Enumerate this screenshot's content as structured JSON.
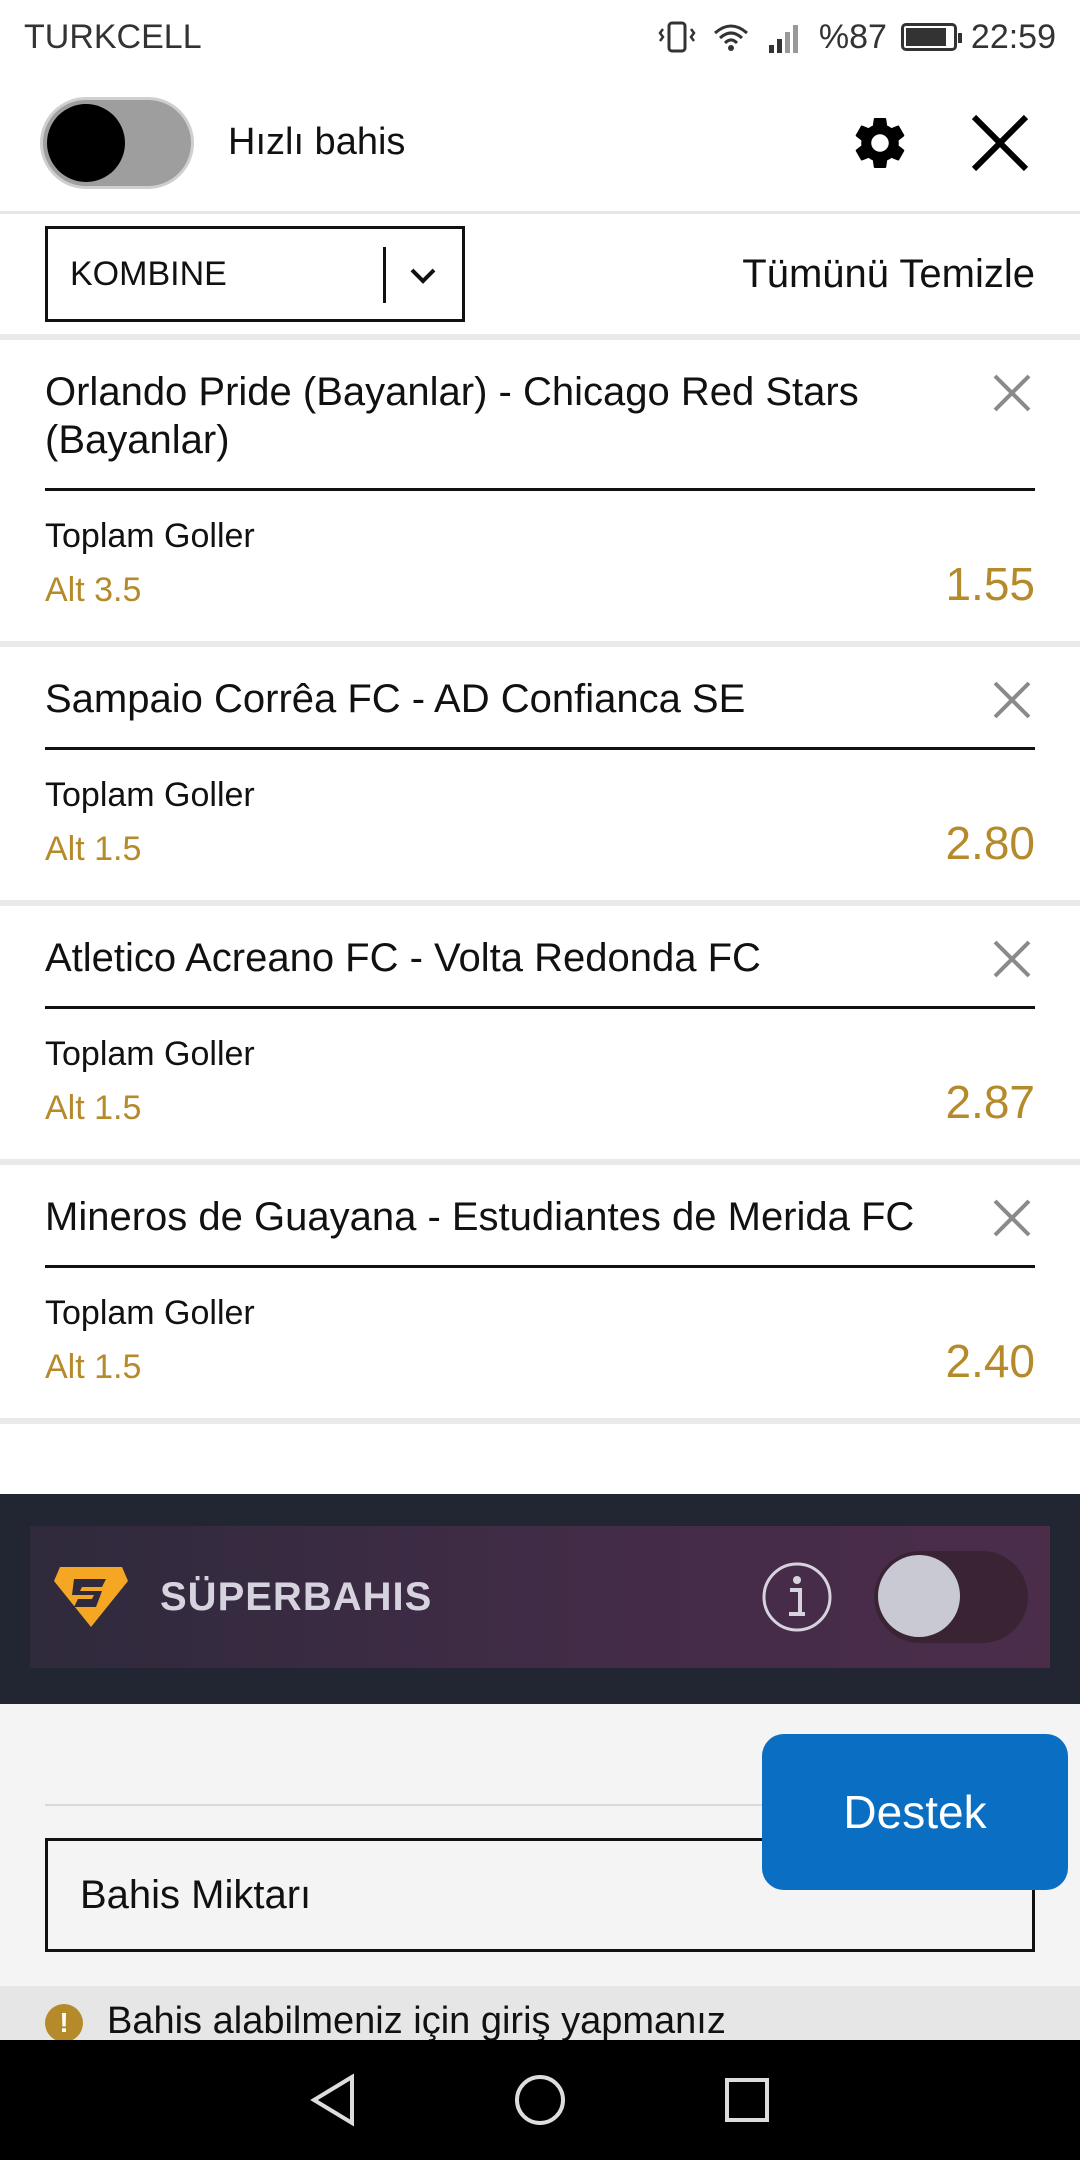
{
  "status_bar": {
    "carrier": "TURKCELL",
    "battery": "%87",
    "time": "22:59"
  },
  "header": {
    "quick_bet_label": "Hızlı bahis",
    "quick_bet_enabled": false
  },
  "bet_mode": {
    "selected": "KOMBINE",
    "clear_all": "Tümünü Temizle"
  },
  "bets": [
    {
      "match": "Orlando Pride (Bayanlar) - Chicago Red Stars (Bayanlar)",
      "market": "Toplam Goller",
      "selection": "Alt 3.5",
      "odds": "1.55"
    },
    {
      "match": "Sampaio Corrêa FC - AD Confianca SE",
      "market": "Toplam Goller",
      "selection": "Alt 1.5",
      "odds": "2.80"
    },
    {
      "match": "Atletico Acreano FC - Volta Redonda FC",
      "market": "Toplam Goller",
      "selection": "Alt 1.5",
      "odds": "2.87"
    },
    {
      "match": "Mineros de Guayana - Estudiantes de Merida FC",
      "market": "Toplam Goller",
      "selection": "Alt 1.5",
      "odds": "2.40"
    }
  ],
  "superbahis": {
    "label": "SÜPERBAHIS",
    "enabled": false
  },
  "stake": {
    "placeholder": "Bahis Miktarı"
  },
  "support_button": "Destek",
  "notice": "Bahis alabilmeniz için giriş yapmanız",
  "colors": {
    "accent_gold": "#b58a2b",
    "support_blue": "#0a6fc2",
    "super_bg": "#222633"
  }
}
